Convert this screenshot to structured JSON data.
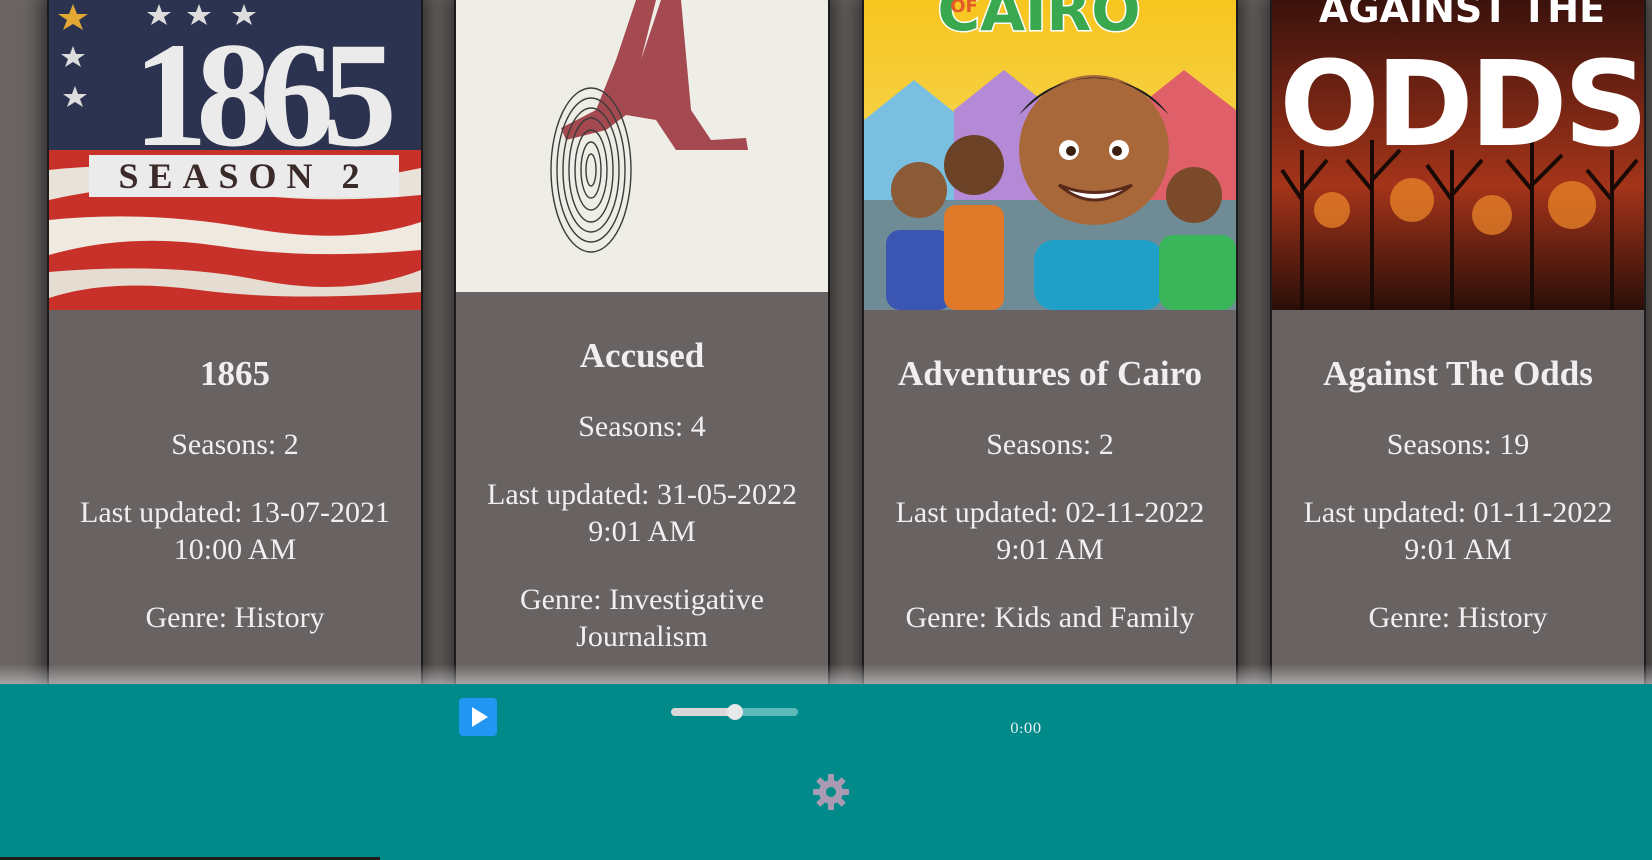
{
  "shows": [
    {
      "poster_text_main": "1865",
      "poster_text_sub": "SEASON 2",
      "title": "1865",
      "seasons": "Seasons: 2",
      "updated_line1": "Last updated: 13-07-2021",
      "updated_line2": "10:00 AM",
      "genre_line1": "Genre: History",
      "genre_line2": ""
    },
    {
      "poster_text_main": "A",
      "poster_text_sub": "",
      "title": "Accused",
      "seasons": "Seasons: 4",
      "updated_line1": "Last updated: 31-05-2022",
      "updated_line2": "9:01 AM",
      "genre_line1": "Genre: Investigative",
      "genre_line2": "Journalism"
    },
    {
      "poster_text_main": "CAIRO",
      "poster_text_sub": "OF",
      "title": "Adventures of Cairo",
      "seasons": "Seasons: 2",
      "updated_line1": "Last updated: 02-11-2022",
      "updated_line2": "9:01 AM",
      "genre_line1": "Genre: Kids and Family",
      "genre_line2": ""
    },
    {
      "poster_text_main": "ODDS",
      "poster_text_sub": "AGAINST THE",
      "title": "Against The Odds",
      "seasons": "Seasons: 19",
      "updated_line1": "Last updated: 01-11-2022",
      "updated_line2": "9:01 AM",
      "genre_line1": "Genre: History",
      "genre_line2": ""
    }
  ],
  "player": {
    "time": "0:00",
    "volume_fraction": 0.5,
    "play_icon": "play-icon",
    "settings_icon": "gear-icon",
    "accent_color": "#2196f3",
    "bar_color": "#008a8a"
  }
}
